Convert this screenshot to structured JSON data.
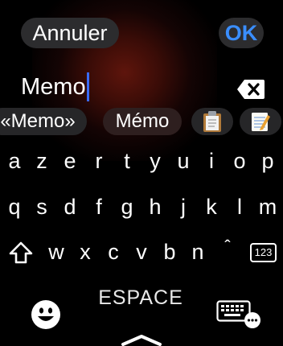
{
  "header": {
    "cancel_label": "Annuler",
    "ok_label": "OK"
  },
  "input": {
    "value": "Memo"
  },
  "suggestions": [
    "«Memo»",
    "Mémo"
  ],
  "keyboard": {
    "row1": [
      "a",
      "z",
      "e",
      "r",
      "t",
      "y",
      "u",
      "i",
      "o",
      "p"
    ],
    "row2": [
      "q",
      "s",
      "d",
      "f",
      "g",
      "h",
      "j",
      "k",
      "l",
      "m"
    ],
    "row3": [
      "w",
      "x",
      "c",
      "v",
      "b",
      "n"
    ],
    "accent_key": "ˆ",
    "numbers_key": "123",
    "space_label": "ESPACE"
  },
  "icons": {
    "delete": "delete-backspace-icon",
    "shift": "shift-icon",
    "emoji": "emoji-icon",
    "keyboard": "keyboard-more-icon",
    "clipboard": "clipboard-icon",
    "notes": "notes-icon",
    "home": "chevron-up-icon"
  },
  "colors": {
    "accent": "#3a8eff",
    "cursor": "#3a6bff",
    "pill": "#2c2c2e"
  }
}
